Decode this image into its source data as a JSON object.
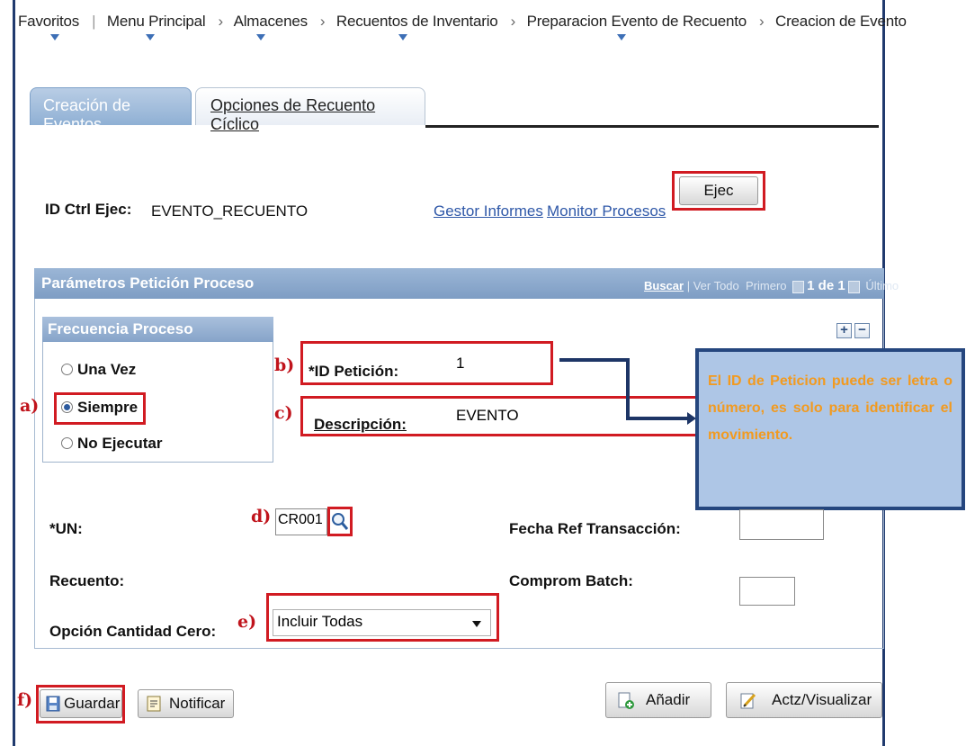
{
  "breadcrumb": [
    "Favoritos",
    "Menu Principal",
    "Almacenes",
    "Recuentos de Inventario",
    "Preparacion Evento de Recuento",
    "Creacion de Evento"
  ],
  "tabs": {
    "active": "Creación de Eventos",
    "inactive": "Opciones de Recuento Cíclico"
  },
  "run_control": {
    "label": "ID Ctrl Ejec:",
    "value": "EVENTO_RECUENTO",
    "link_report": "Gestor Informes",
    "link_monitor": "Monitor Procesos",
    "run_button": "Ejec"
  },
  "panel": {
    "title": "Parámetros Petición Proceso",
    "search": "Buscar",
    "view_all": "Ver Todo",
    "first": "Primero",
    "count": "1 de 1",
    "last": "Último",
    "add": "+",
    "remove": "−"
  },
  "frequency": {
    "title": "Frecuencia Proceso",
    "options": [
      "Una Vez",
      "Siempre",
      "No Ejecutar"
    ],
    "selected": "Siempre"
  },
  "request": {
    "id_label": "*ID Petición:",
    "id_value": "1",
    "desc_label": "Descripción:",
    "desc_value": "EVENTO"
  },
  "fields": {
    "un_label": "*UN:",
    "un_value": "CR001",
    "fecha_label": "Fecha Ref Transacción:",
    "recuento_label": "Recuento:",
    "comprom_label": "Comprom Batch:",
    "zero_label": "Opción Cantidad Cero:",
    "zero_value": "Incluir Todas"
  },
  "buttons": {
    "save": "Guardar",
    "notify": "Notificar",
    "add": "Añadir",
    "update": "Actz/Visualizar"
  },
  "annotations": {
    "a": "a)",
    "b": "b)",
    "c": "c)",
    "d": "d)",
    "e": "e)",
    "f": "f)"
  },
  "callout": "El ID de Peticion puede ser letra o número, es solo para identificar el movimiento.",
  "colors": {
    "highlight": "#d11b22",
    "callout_bg": "#aec6e6",
    "callout_text": "#f29a1f",
    "header_blue": "#8fb0d4"
  }
}
